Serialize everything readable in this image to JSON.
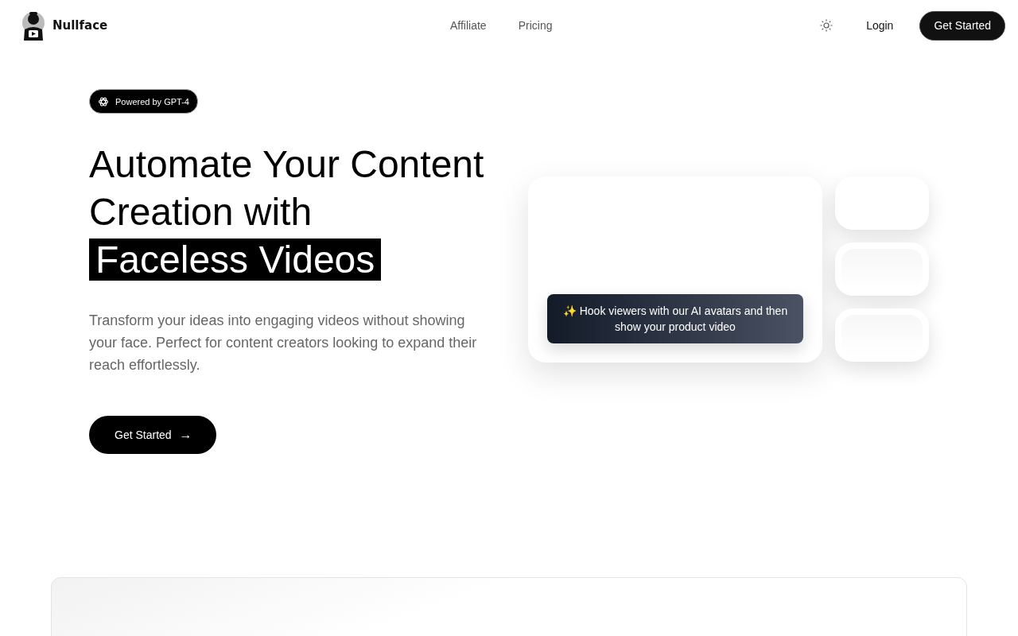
{
  "brand": {
    "name": "Nullface"
  },
  "nav": [
    {
      "label": "Affiliate"
    },
    {
      "label": "Pricing"
    }
  ],
  "header_actions": {
    "login": "Login",
    "cta": "Get Started"
  },
  "hero": {
    "badge": "Powered by GPT-4",
    "title_lines": [
      "Automate Your Content",
      "Creation with"
    ],
    "title_highlight": "Faceless Videos",
    "description": "Transform your ideas into engaging videos without showing your face. Perfect for content creators looking to expand their reach effortlessly.",
    "cta": "Get Started",
    "cta_arrow": "→"
  },
  "preview": {
    "caption": "✨ Hook viewers with our AI avatars and then show your product video",
    "thumbnails": [
      {
        "kind": "plain"
      },
      {
        "kind": "inset"
      },
      {
        "kind": "inset"
      }
    ]
  }
}
